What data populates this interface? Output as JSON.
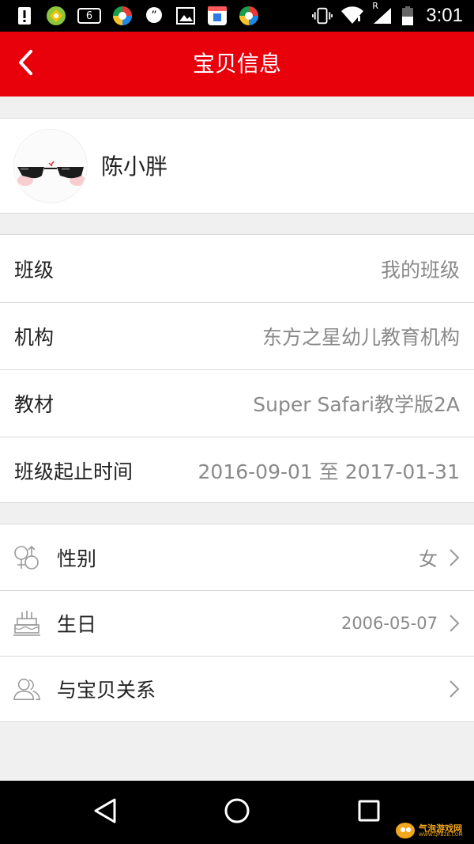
{
  "status_bar": {
    "time": "3:01",
    "left_icons": [
      "alert-icon",
      "app-icon-green",
      "badge-6-icon",
      "app-icon-color",
      "chat-icon",
      "image-icon",
      "app-icon-store",
      "app-icon-color-2"
    ],
    "notification_badge": "6",
    "right_icons": [
      "vibrate-icon",
      "wifi-icon",
      "signal-icon",
      "battery-icon"
    ],
    "roaming": "R"
  },
  "header": {
    "title": "宝贝信息",
    "background": "#e8000b"
  },
  "profile": {
    "name": "陈小胖"
  },
  "info": {
    "rows": [
      {
        "label": "班级",
        "value": "我的班级"
      },
      {
        "label": "机构",
        "value": "东方之星幼儿教育机构"
      },
      {
        "label": "教材",
        "value": "Super Safari教学版2A"
      },
      {
        "label": "班级起止时间",
        "value": "2016-09-01 至 2017-01-31"
      }
    ]
  },
  "settings": {
    "rows": [
      {
        "icon": "gender-icon",
        "label": "性别",
        "value": "女"
      },
      {
        "icon": "birthday-cake-icon",
        "label": "生日",
        "value": "2006-05-07"
      },
      {
        "icon": "people-icon",
        "label": "与宝贝关系",
        "value": ""
      }
    ]
  },
  "nav": {
    "buttons": [
      "back-triangle-icon",
      "home-circle-icon",
      "recents-square-icon"
    ]
  },
  "watermark": {
    "text": "气泡游戏网",
    "subtext": "WWW.QPBZB.COM"
  }
}
